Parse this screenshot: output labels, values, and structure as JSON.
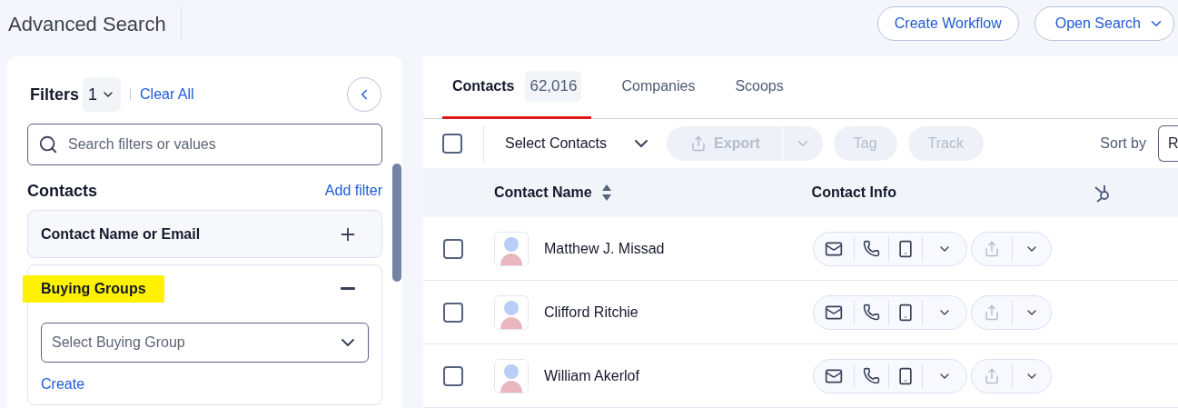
{
  "header": {
    "title": "Advanced Search",
    "workflow_button": "Create Workflow",
    "open_search": "Open Search"
  },
  "filters": {
    "title": "Filters",
    "count": "1",
    "clear": "Clear All",
    "search_placeholder": "Search filters or values",
    "section": "Contacts",
    "add_filter": "Add filter",
    "groups": [
      {
        "label": "Contact Name or Email",
        "expanded": false,
        "highlighted": false
      },
      {
        "label": "Buying Groups",
        "expanded": true,
        "highlighted": true,
        "select_placeholder": "Select Buying Group",
        "link": "Create"
      }
    ]
  },
  "tabs": [
    {
      "label": "Contacts",
      "count": "62,016",
      "selected": true
    },
    {
      "label": "Companies",
      "selected": false
    },
    {
      "label": "Scoops",
      "selected": false
    }
  ],
  "toolbar": {
    "select": "Select Contacts",
    "checked": false,
    "actions": [
      {
        "label": "Export",
        "disabled": true,
        "kind": "split"
      },
      {
        "label": "Tag",
        "disabled": true,
        "kind": "plain"
      },
      {
        "label": "Track",
        "disabled": true,
        "kind": "plain"
      }
    ],
    "sort_label": "Sort by",
    "sort_value": "R"
  },
  "table": {
    "columns": [
      "Contact Name",
      "Contact Info"
    ],
    "rows": [
      {
        "name": "Matthew J. Missad",
        "checked": false
      },
      {
        "name": "Clifford Ritchie",
        "checked": false
      },
      {
        "name": "William Akerlof",
        "checked": false
      }
    ]
  }
}
